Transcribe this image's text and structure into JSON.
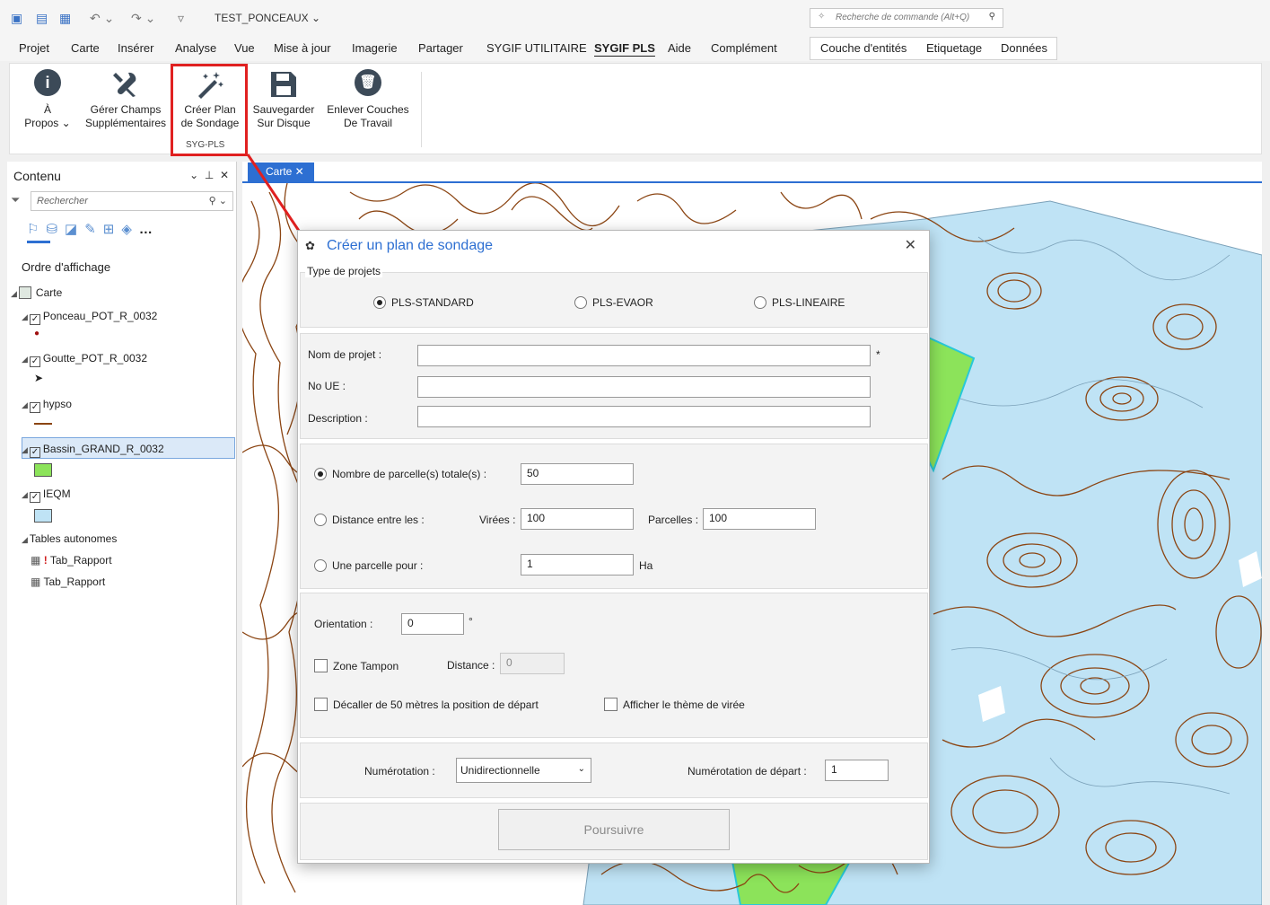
{
  "app": {
    "title": "TEST_PONCEAUX"
  },
  "command_search": {
    "placeholder": "Recherche de commande (Alt+Q)"
  },
  "menus": [
    "Projet",
    "Carte",
    "Insérer",
    "Analyse",
    "Vue",
    "Mise à jour",
    "Imagerie",
    "Partager",
    "SYGIF UTILITAIRE",
    "SYGIF PLS",
    "Aide",
    "Complément"
  ],
  "active_menu": "SYGIF PLS",
  "context_tabs": [
    "Couche d'entités",
    "Etiquetage",
    "Données"
  ],
  "ribbon": {
    "buttons": [
      {
        "line1": "À",
        "line2": "Propos ⌄",
        "icon": "info-icon"
      },
      {
        "line1": "Gérer Champs",
        "line2": "Supplémentaires",
        "icon": "tools-icon"
      },
      {
        "line1": "Créer Plan",
        "line2": "de Sondage",
        "icon": "magic-wand-icon"
      },
      {
        "line1": "Sauvegarder",
        "line2": "Sur Disque",
        "icon": "save-icon"
      },
      {
        "line1": "Enlever Couches",
        "line2": "De Travail",
        "icon": "trash-icon"
      }
    ],
    "group_label": "SYG-PLS"
  },
  "contents_pane": {
    "title": "Contenu",
    "search_placeholder": "Rechercher",
    "order_label": "Ordre d'affichage",
    "layers": [
      {
        "name": "Carte"
      },
      {
        "name": "Ponceau_POT_R_0032"
      },
      {
        "name": "Goutte_POT_R_0032"
      },
      {
        "name": "hypso"
      },
      {
        "name": "Bassin_GRAND_R_0032"
      },
      {
        "name": "IEQM"
      }
    ],
    "standalone_label": "Tables autonomes",
    "tables": [
      "Tab_Rapport",
      "Tab_Rapport"
    ]
  },
  "map_tab": {
    "label": "Carte"
  },
  "dialog": {
    "title": "Créer un plan de sondage",
    "project_type_label": "Type de projets",
    "project_types": [
      "PLS-STANDARD",
      "PLS-EVAOR",
      "PLS-LINEAIRE"
    ],
    "selected_type": "PLS-STANDARD",
    "fields": {
      "nom_label": "Nom de projet :",
      "nom_value": "",
      "required_mark": "*",
      "ue_label": "No UE :",
      "ue_value": "",
      "desc_label": "Description :",
      "desc_value": ""
    },
    "parcelles": {
      "total_label": "Nombre de parcelle(s) totale(s) :",
      "total_value": "50",
      "distance_label": "Distance entre les :",
      "virees_label": "Virées :",
      "virees_value": "100",
      "parcelles_label": "Parcelles :",
      "parcelles_value": "100",
      "une_label": "Une parcelle pour :",
      "une_value": "1",
      "une_unit": "Ha"
    },
    "options": {
      "orientation_label": "Orientation :",
      "orientation_value": "0",
      "degree": "°",
      "zone_label": "Zone Tampon",
      "distance_label": "Distance :",
      "distance_value": "0",
      "decaler_label": "Décaller de 50 mètres la position de départ",
      "afficher_label": "Afficher le thème de virée"
    },
    "numerotation": {
      "label": "Numérotation :",
      "value": "Unidirectionnelle",
      "start_label": "Numérotation de départ :",
      "start_value": "1"
    },
    "submit_label": "Poursuivre"
  },
  "colors": {
    "accent": "#2d6fd2",
    "highlight": "#e02020",
    "contour": "#8b4513",
    "water": "#bfe3f5",
    "green": "#8ce35a"
  }
}
